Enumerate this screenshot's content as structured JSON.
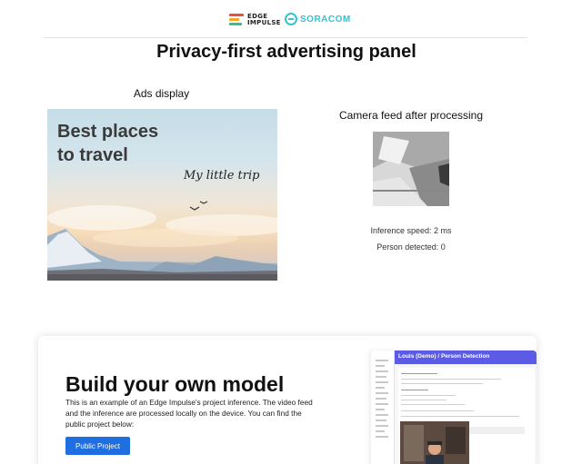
{
  "header": {
    "edge_impulse_logo_text": "EDGE IMPULSE",
    "soracom_logo_text": "SORACOM",
    "brand_colors": {
      "edge_impulse_bars": [
        "#e94f3d",
        "#f6a623",
        "#3bbf8a"
      ],
      "soracom": "#34c3cf"
    }
  },
  "page_title": "Privacy-first advertising panel",
  "ads": {
    "label": "Ads display",
    "title_line1": "Best places",
    "title_line2": "to travel",
    "tagline": "My little trip"
  },
  "camera": {
    "label": "Camera feed after processing",
    "inference_speed": "Inference speed: 2 ms",
    "person_detected": "Person detected: 0"
  },
  "promo": {
    "title": "Build your own model",
    "description": "This is an example of an Edge Impulse's project inference. The video feed and the inference are processed locally on the device. You can find the public project below:",
    "button_label": "Public Project",
    "button_color": "#1f6fe0",
    "screenshot": {
      "header_title": "Louis (Demo) / Person Detection",
      "header_color": "#5b5be6"
    }
  }
}
